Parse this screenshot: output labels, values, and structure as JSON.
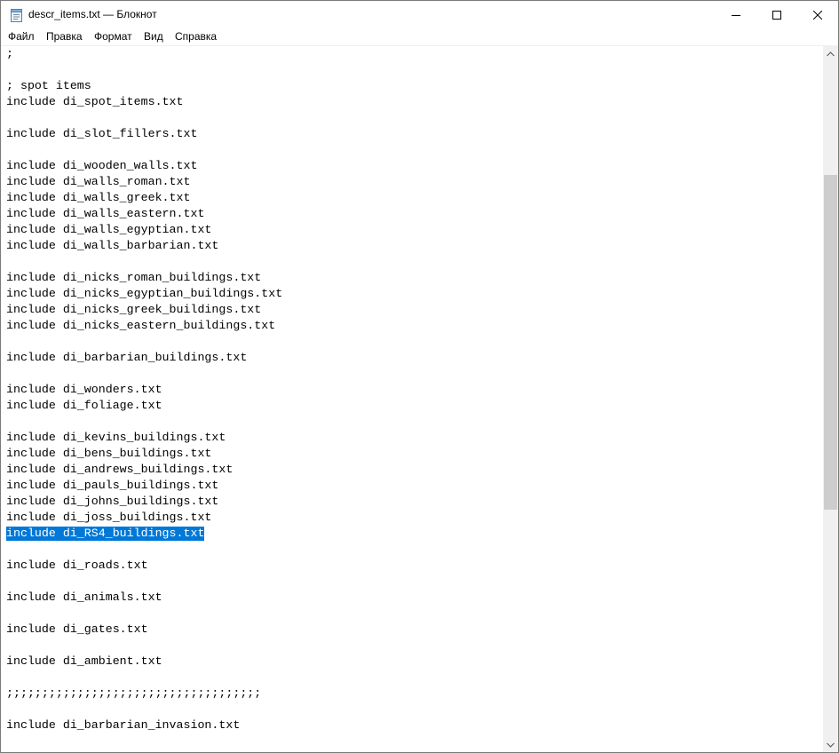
{
  "window": {
    "title": "descr_items.txt — Блокнот",
    "app_icon": "notepad-icon",
    "controls": {
      "minimize_icon": "minimize-icon",
      "maximize_icon": "maximize-icon",
      "close_icon": "close-icon"
    }
  },
  "menu": [
    {
      "label": "Файл"
    },
    {
      "label": "Правка"
    },
    {
      "label": "Формат"
    },
    {
      "label": "Вид"
    },
    {
      "label": "Справка"
    }
  ],
  "editor": {
    "lines": [
      ";",
      "",
      "; spot items",
      "include di_spot_items.txt",
      "",
      "include di_slot_fillers.txt",
      "",
      "include di_wooden_walls.txt",
      "include di_walls_roman.txt",
      "include di_walls_greek.txt",
      "include di_walls_eastern.txt",
      "include di_walls_egyptian.txt",
      "include di_walls_barbarian.txt",
      "",
      "include di_nicks_roman_buildings.txt",
      "include di_nicks_egyptian_buildings.txt",
      "include di_nicks_greek_buildings.txt",
      "include di_nicks_eastern_buildings.txt",
      "",
      "include di_barbarian_buildings.txt",
      "",
      "include di_wonders.txt",
      "include di_foliage.txt",
      "",
      "include di_kevins_buildings.txt",
      "include di_bens_buildings.txt",
      "include di_andrews_buildings.txt",
      "include di_pauls_buildings.txt",
      "include di_johns_buildings.txt",
      "include di_joss_buildings.txt",
      "include di_RS4_buildings.txt",
      "",
      "include di_roads.txt",
      "",
      "include di_animals.txt",
      "",
      "include di_gates.txt",
      "",
      "include di_ambient.txt",
      "",
      ";;;;;;;;;;;;;;;;;;;;;;;;;;;;;;;;;;;;",
      "",
      "include di_barbarian_invasion.txt"
    ],
    "selected_line_index": 30,
    "selection_color": "#0078d7"
  },
  "scrollbar": {
    "up_icon": "scroll-up-arrow-icon",
    "down_icon": "scroll-down-arrow-icon"
  }
}
